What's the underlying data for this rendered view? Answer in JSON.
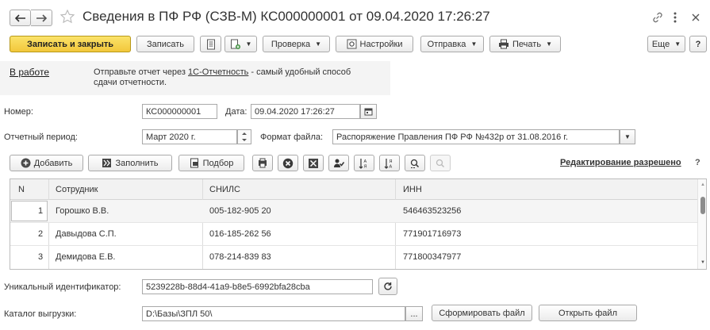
{
  "window": {
    "title": "Сведения в ПФ РФ (СЗВ-М) КС000000001 от 09.04.2020 17:26:27"
  },
  "toolbar": {
    "save_close_label": "Записать и закрыть",
    "save_label": "Записать",
    "check_label": "Проверка",
    "settings_label": "Настройки",
    "send_label": "Отправка",
    "print_label": "Печать",
    "more_label": "Еще",
    "help_label": "?"
  },
  "info": {
    "status_link": "В работе",
    "message_prefix": "Отправьте отчет через",
    "message_link": "1С-Отчетность",
    "message_suffix": " - самый удобный способ",
    "message_line2": "сдачи отчетности."
  },
  "form": {
    "number_label": "Номер:",
    "number_value": "КС000000001",
    "date_label": "Дата:",
    "date_value": "09.04.2020 17:26:27",
    "period_label": "Отчетный период:",
    "period_value": "Март 2020 г.",
    "format_label": "Формат файла:",
    "format_value": "Распоряжение Правления ПФ РФ №432р от 31.08.2016 г."
  },
  "table_toolbar": {
    "add_label": "Добавить",
    "fill_label": "Заполнить",
    "select_label": "Подбор",
    "edit_allowed_label": "Редактирование разрешено",
    "help_label": "?"
  },
  "table": {
    "columns": [
      "N",
      "Сотрудник",
      "СНИЛС",
      "ИНН"
    ],
    "rows": [
      {
        "n": "1",
        "employee": "Горошко В.В.",
        "snils": "005-182-905 20",
        "inn": "546463523256"
      },
      {
        "n": "2",
        "employee": "Давыдова С.П.",
        "snils": "016-185-262 56",
        "inn": "771901716973"
      },
      {
        "n": "3",
        "employee": "Демидова Е.В.",
        "snils": "078-214-839 83",
        "inn": "771800347977"
      }
    ]
  },
  "footer": {
    "uid_label": "Уникальный идентификатор:",
    "uid_value": "5239228b-88d4-41a9-b8e5-6992bfa28cba",
    "catalog_label": "Каталог выгрузки:",
    "catalog_value": "D:\\Базы\\ЗПЛ 50\\",
    "browse_label": "...",
    "make_file_label": "Сформировать файл",
    "open_file_label": "Открыть файл"
  },
  "colors": {
    "primary_button": "#f2c73b",
    "link": "#1a1a1a",
    "selected_row": "#f5f5f5",
    "info_background": "#f4f4f4"
  }
}
